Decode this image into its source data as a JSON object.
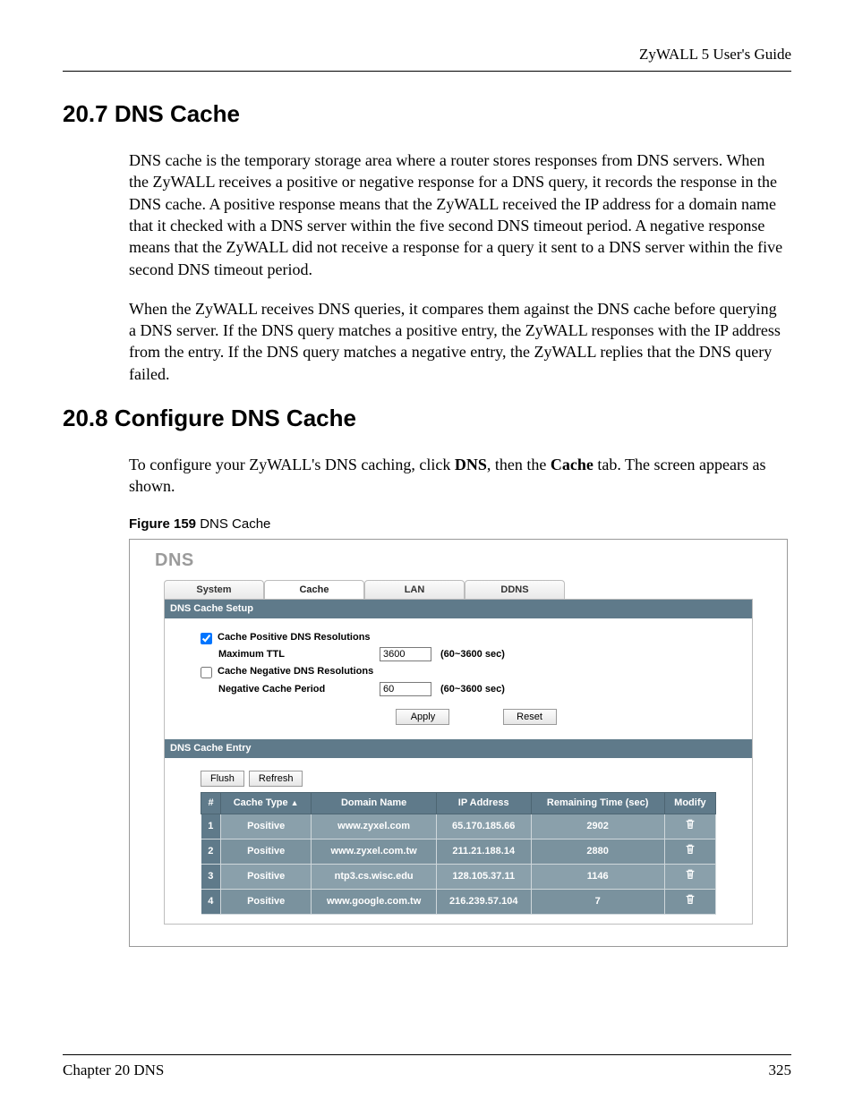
{
  "doc": {
    "header_right": "ZyWALL 5 User's Guide",
    "footer_left": "Chapter 20 DNS",
    "footer_right": "325"
  },
  "s1": {
    "heading": "20.7  DNS Cache",
    "p1": "DNS cache is the temporary storage area where a router stores responses from DNS servers. When the ZyWALL receives a positive or negative response for a DNS query, it records the response in the DNS cache. A positive response means that the ZyWALL received the IP address for a domain name that it checked with a DNS server within the five second DNS timeout period. A negative response means that the ZyWALL did not receive a response for a query it sent to a DNS server within the five second DNS timeout period.",
    "p2": "When the ZyWALL receives DNS queries, it compares them against the DNS cache before querying a DNS server. If the DNS query matches a positive entry, the ZyWALL responses with the IP address from the entry. If the DNS query matches a negative entry, the ZyWALL replies that the DNS query failed."
  },
  "s2": {
    "heading": "20.8  Configure DNS Cache",
    "intro_pre": "To configure your ZyWALL's DNS caching, click ",
    "intro_b1": "DNS",
    "intro_mid": ", then the ",
    "intro_b2": "Cache",
    "intro_post": " tab. The screen appears as shown.",
    "fig_label": "Figure 159",
    "fig_title": "   DNS Cache"
  },
  "ui": {
    "app_title": "DNS",
    "tabs": {
      "t1": "System",
      "t2": "Cache",
      "t3": "LAN",
      "t4": "DDNS"
    },
    "setup": {
      "bar": "DNS Cache Setup",
      "cb_pos": "Cache Positive DNS Resolutions",
      "max_ttl_lbl": "Maximum TTL",
      "max_ttl_val": "3600",
      "ttl_hint": "(60~3600 sec)",
      "cb_neg": "Cache Negative DNS Resolutions",
      "neg_lbl": "Negative Cache Period",
      "neg_val": "60",
      "neg_hint": "(60~3600 sec)",
      "apply": "Apply",
      "reset": "Reset"
    },
    "entry": {
      "bar": "DNS Cache Entry",
      "flush": "Flush",
      "refresh": "Refresh",
      "cols": {
        "idx": "#",
        "type": "Cache Type",
        "domain": "Domain Name",
        "ip": "IP Address",
        "remain": "Remaining Time (sec)",
        "modify": "Modify"
      },
      "rows": [
        {
          "n": "1",
          "type": "Positive",
          "domain": "www.zyxel.com",
          "ip": "65.170.185.66",
          "remain": "2902"
        },
        {
          "n": "2",
          "type": "Positive",
          "domain": "www.zyxel.com.tw",
          "ip": "211.21.188.14",
          "remain": "2880"
        },
        {
          "n": "3",
          "type": "Positive",
          "domain": "ntp3.cs.wisc.edu",
          "ip": "128.105.37.11",
          "remain": "1146"
        },
        {
          "n": "4",
          "type": "Positive",
          "domain": "www.google.com.tw",
          "ip": "216.239.57.104",
          "remain": "7"
        }
      ]
    }
  }
}
